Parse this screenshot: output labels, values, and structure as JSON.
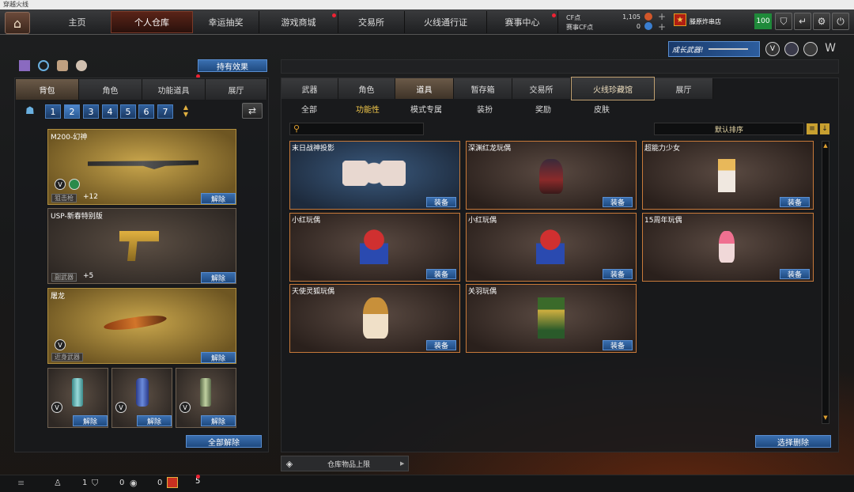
{
  "window": {
    "title": "穿越火线"
  },
  "nav": {
    "tabs": [
      "主页",
      "个人仓库",
      "幸运抽奖",
      "游戏商城",
      "交易所",
      "火线通行证",
      "赛事中心"
    ],
    "active": "个人仓库"
  },
  "currency": {
    "cf_label": "CF点",
    "cf_value": "1,105",
    "event_label": "赛事CF点",
    "event_value": "0"
  },
  "user": {
    "name": "滕原炸串店",
    "level": "100"
  },
  "banner": {
    "text": "成长武器!"
  },
  "left": {
    "effects_button": "持有效果",
    "tabs": [
      "背包",
      "角色",
      "功能道具",
      "展厅"
    ],
    "pages": [
      "1",
      "2",
      "3",
      "4",
      "5",
      "6",
      "7"
    ],
    "active_page": "2",
    "cards": [
      {
        "name": "M200-幻神",
        "type": "狙击枪",
        "bonus": "+12",
        "action": "解除"
      },
      {
        "name": "USP-新春特别版",
        "type": "副武器",
        "bonus": "+5",
        "action": "解除"
      },
      {
        "name": "屠龙",
        "type": "近身武器",
        "action": "解除"
      }
    ],
    "grenades": [
      {
        "action": "解除"
      },
      {
        "action": "解除"
      },
      {
        "action": "解除"
      }
    ],
    "release_all": "全部解除"
  },
  "right": {
    "tabs": [
      "武器",
      "角色",
      "道具",
      "暂存箱",
      "交易所",
      "火线珍藏馆",
      "展厅"
    ],
    "active_tab": "道具",
    "highlight_tab": "火线珍藏馆",
    "subtabs": [
      "全部",
      "功能性",
      "模式专属",
      "装扮",
      "奖励",
      "皮肤"
    ],
    "active_subtab": "功能性",
    "sort_label": "默认排序",
    "items": [
      {
        "name": "末日战神投影",
        "action": "装备"
      },
      {
        "name": "深渊红龙玩偶",
        "action": "装备"
      },
      {
        "name": "超能力少女",
        "action": "装备"
      },
      {
        "name": "小红玩偶",
        "action": "装备"
      },
      {
        "name": "小红玩偶",
        "action": "装备"
      },
      {
        "name": "15周年玩偶",
        "action": "装备"
      },
      {
        "name": "天使灵狐玩偶",
        "action": "装备"
      },
      {
        "name": "关羽玩偶",
        "action": "装备"
      }
    ],
    "select_delete": "选择删除",
    "storage_limit": "仓库物品上限"
  },
  "status": {
    "friends": "1",
    "guild": "0",
    "chat": "0",
    "gifts": "5"
  }
}
